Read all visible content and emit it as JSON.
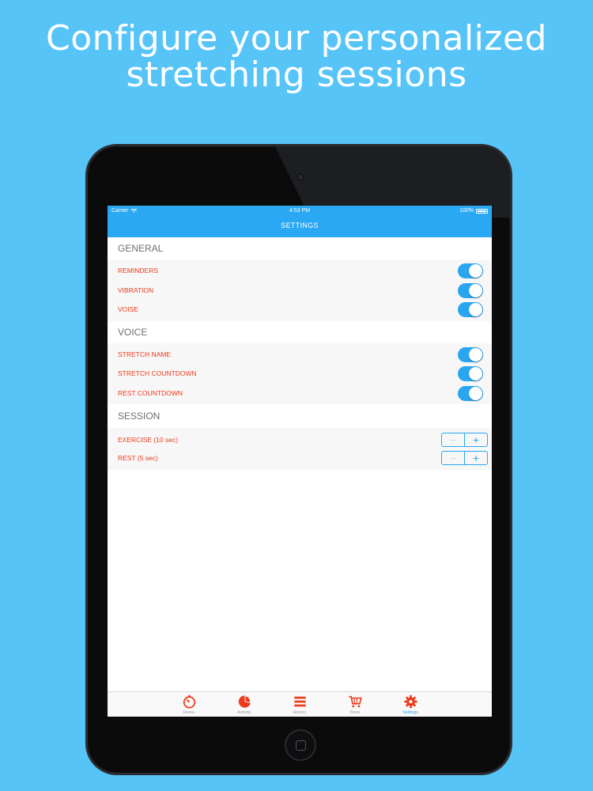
{
  "headline": {
    "line1": "Configure your personalized",
    "line2": "stretching sessions"
  },
  "status_bar": {
    "carrier": "Carrier",
    "time": "4:53 PM",
    "battery": "100%"
  },
  "nav": {
    "title": "SETTINGS"
  },
  "sections": {
    "general": {
      "header": "GENERAL",
      "rows": [
        {
          "label": "REMINDERS",
          "on": true
        },
        {
          "label": "VIBRATION",
          "on": true
        },
        {
          "label": "VOISE",
          "on": true
        }
      ]
    },
    "voice": {
      "header": "VOICE",
      "rows": [
        {
          "label": "STRETCH NAME",
          "on": true
        },
        {
          "label": "STRETCH COUNTDOWN",
          "on": true
        },
        {
          "label": "REST COUNTDOWN",
          "on": true
        }
      ]
    },
    "session": {
      "header": "SESSION",
      "rows": [
        {
          "label": "EXERCISE (10 sec)",
          "minus": "−",
          "plus": "+"
        },
        {
          "label": "REST (5 sec)",
          "minus": "−",
          "plus": "+"
        }
      ]
    }
  },
  "tabbar": {
    "items": [
      {
        "label": "Home",
        "icon": "stopwatch-icon"
      },
      {
        "label": "Activity",
        "icon": "pie-chart-icon"
      },
      {
        "label": "History",
        "icon": "list-icon"
      },
      {
        "label": "Store",
        "icon": "cart-icon"
      },
      {
        "label": "Settings",
        "icon": "gear-icon",
        "active": true
      }
    ]
  },
  "colors": {
    "background": "#57c4f8",
    "nav": "#2ba8f3",
    "accent": "#2aa6f0",
    "label": "#ec3b1c",
    "tab_icon": "#ec3b1c"
  }
}
